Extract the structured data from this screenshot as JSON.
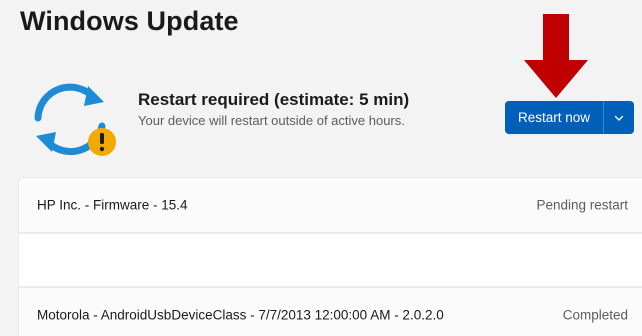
{
  "page": {
    "title": "Windows Update"
  },
  "status": {
    "heading": "Restart required (estimate: 5 min)",
    "subtext": "Your device will restart outside of active hours.",
    "icon": "sync-arrows-icon",
    "badge_icon": "warning-badge-icon"
  },
  "actions": {
    "restart_label": "Restart now",
    "dropdown_icon": "chevron-down-icon"
  },
  "annotation": {
    "icon": "red-arrow-down-icon",
    "color": "#c00000"
  },
  "updates": [
    {
      "name": "HP Inc. - Firmware - 15.4",
      "status": "Pending restart"
    },
    {
      "name": "",
      "status": ""
    },
    {
      "name": "Motorola - AndroidUsbDeviceClass - 7/7/2013 12:00:00 AM - 2.0.2.0",
      "status": "Completed"
    }
  ],
  "colors": {
    "accent": "#005fb8",
    "sync_blue": "#1e8bd6",
    "warning": "#f2a900",
    "background": "#f3f3f3"
  }
}
